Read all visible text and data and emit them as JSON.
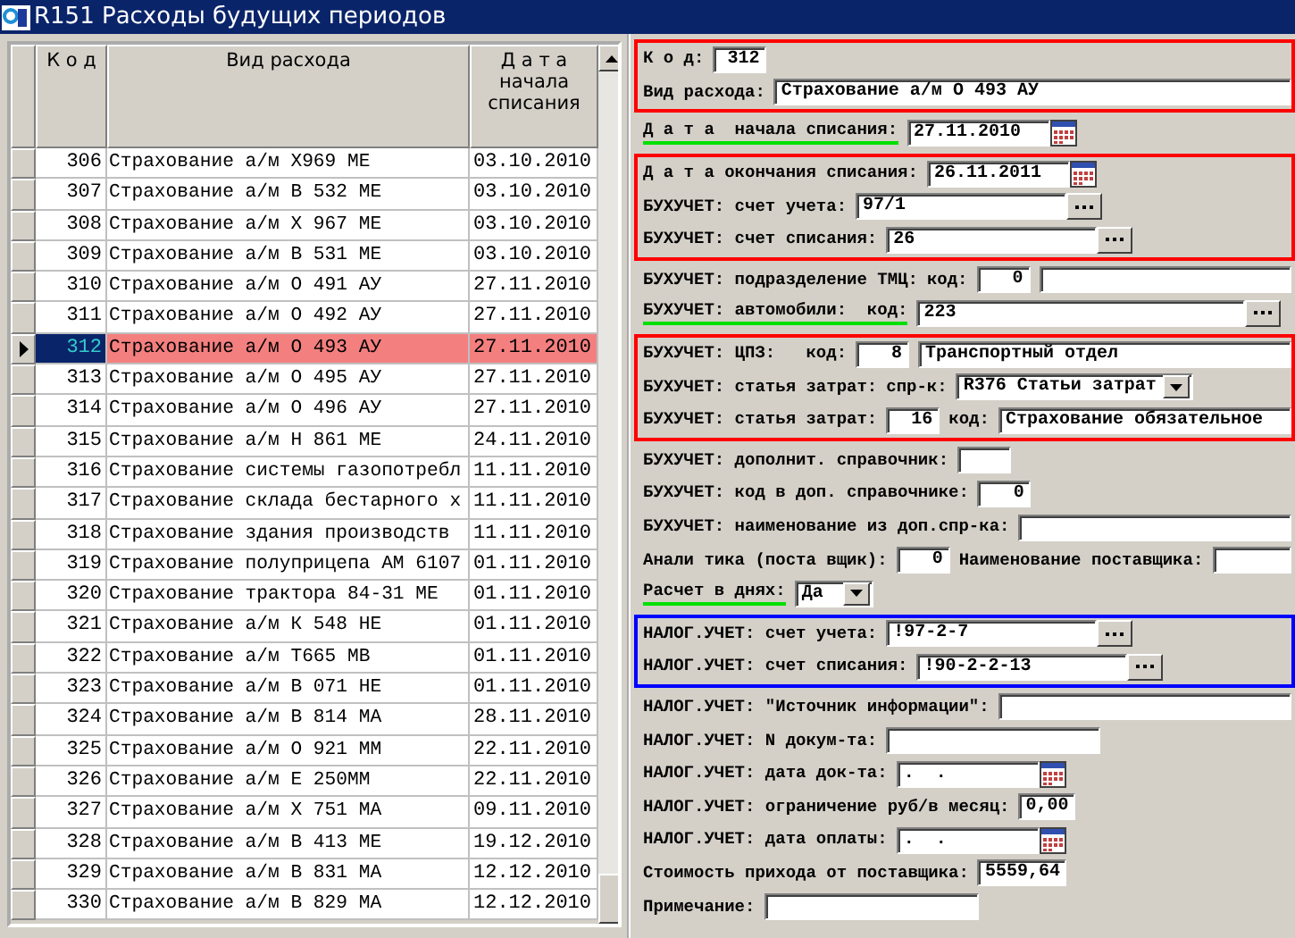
{
  "window": {
    "title": "R151 Расходы будущих периодов"
  },
  "table": {
    "columns": [
      "К о д",
      "Вид расхода",
      "Д а т а\nначала\nсписания"
    ],
    "rows": [
      {
        "code": "306",
        "name": "Страхование а/м Х969 МЕ",
        "date": "03.10.2010",
        "selected": false
      },
      {
        "code": "307",
        "name": "Страхование а/м В 532 МЕ",
        "date": "03.10.2010",
        "selected": false
      },
      {
        "code": "308",
        "name": "Страхование а/м Х 967 МЕ",
        "date": "03.10.2010",
        "selected": false
      },
      {
        "code": "309",
        "name": "Страхование а/м В 531 МЕ",
        "date": "03.10.2010",
        "selected": false
      },
      {
        "code": "310",
        "name": "Страхование а/м О 491 АУ",
        "date": "27.11.2010",
        "selected": false
      },
      {
        "code": "311",
        "name": "Страхование а/м О 492 АУ",
        "date": "27.11.2010",
        "selected": false
      },
      {
        "code": "312",
        "name": "Страхование а/м О 493 АУ",
        "date": "27.11.2010",
        "selected": true
      },
      {
        "code": "313",
        "name": "Страхование а/м О 495 АУ",
        "date": "27.11.2010",
        "selected": false
      },
      {
        "code": "314",
        "name": "Страхование а/м О 496 АУ",
        "date": "27.11.2010",
        "selected": false
      },
      {
        "code": "315",
        "name": "Страхование а/м Н 861 МЕ",
        "date": "24.11.2010",
        "selected": false
      },
      {
        "code": "316",
        "name": "Страхование системы газопотребл",
        "date": "11.11.2010",
        "selected": false
      },
      {
        "code": "317",
        "name": "Страхование склада бестарного х",
        "date": "11.11.2010",
        "selected": false
      },
      {
        "code": "318",
        "name": "Страхование здания производств",
        "date": "11.11.2010",
        "selected": false
      },
      {
        "code": "319",
        "name": "Страхование полуприцепа АМ 6107",
        "date": "01.11.2010",
        "selected": false
      },
      {
        "code": "320",
        "name": "Страхование трактора 84-31 МЕ",
        "date": "01.11.2010",
        "selected": false
      },
      {
        "code": "321",
        "name": "Страхование а/м К 548 НЕ",
        "date": "01.11.2010",
        "selected": false
      },
      {
        "code": "322",
        "name": "Страхование а/м Т665 МВ",
        "date": "01.11.2010",
        "selected": false
      },
      {
        "code": "323",
        "name": "Страхование а/м В 071 НЕ",
        "date": "01.11.2010",
        "selected": false
      },
      {
        "code": "324",
        "name": "Страхование а/м В 814 МА",
        "date": "28.11.2010",
        "selected": false
      },
      {
        "code": "325",
        "name": "Страхование а/м О 921 ММ",
        "date": "22.11.2010",
        "selected": false
      },
      {
        "code": "326",
        "name": "Страхование а/м Е 250ММ",
        "date": "22.11.2010",
        "selected": false
      },
      {
        "code": "327",
        "name": "Страхование а/м Х 751 МА",
        "date": "09.11.2010",
        "selected": false
      },
      {
        "code": "328",
        "name": "Страхование а/м В 413 МЕ",
        "date": "19.12.2010",
        "selected": false
      },
      {
        "code": "329",
        "name": "Страхование а/м В 831 МА",
        "date": "12.12.2010",
        "selected": false
      },
      {
        "code": "330",
        "name": "Страхование а/м В 829 МА",
        "date": "12.12.2010",
        "selected": false
      }
    ]
  },
  "form": {
    "groups": [
      {
        "color": "#ff0000",
        "rows": [
          {
            "items": [
              {
                "kind": "label",
                "text": "К о д:"
              },
              {
                "kind": "number",
                "value": "312"
              }
            ]
          },
          {
            "items": [
              {
                "kind": "label",
                "text": "Вид расхода:"
              },
              {
                "kind": "wide",
                "value": "Страхование а/м О 493 АУ"
              }
            ]
          }
        ]
      },
      {
        "rows": [
          {
            "items": [
              {
                "kind": "label",
                "text": "Д а т а  начала списания:",
                "underlined": true
              },
              {
                "kind": "date",
                "value": "27.11.2010"
              }
            ]
          }
        ]
      },
      {
        "color": "#ff0000",
        "rows": [
          {
            "items": [
              {
                "kind": "label",
                "text": "Д а т а окончания списания:"
              },
              {
                "kind": "date",
                "value": "26.11.2011"
              }
            ]
          },
          {
            "items": [
              {
                "kind": "label",
                "text": "БУХУЧЕТ: счет учета:"
              },
              {
                "kind": "lookup",
                "value": "97/1"
              }
            ]
          },
          {
            "items": [
              {
                "kind": "label",
                "text": "БУХУЧЕТ: счет списания:"
              },
              {
                "kind": "lookup",
                "value": "26"
              }
            ]
          }
        ]
      },
      {
        "rows": [
          {
            "items": [
              {
                "kind": "label",
                "text": "БУХУЧЕТ: подразделение ТМЦ:"
              },
              {
                "kind": "label",
                "text": "код:"
              },
              {
                "kind": "number",
                "value": "0"
              },
              {
                "kind": "wide"
              }
            ]
          },
          {
            "items": [
              {
                "kind": "label",
                "text": "БУХУЧЕТ: автомобили:  код:",
                "underlined": true
              },
              {
                "kind": "longlookup",
                "value": "223"
              }
            ]
          }
        ]
      },
      {
        "color": "#ff0000",
        "rows": [
          {
            "items": [
              {
                "kind": "label",
                "text": "БУХУЧЕТ: ЦПЗ:   код:"
              },
              {
                "kind": "number",
                "value": "8"
              },
              {
                "kind": "wide",
                "value": "Транспортный отдел"
              }
            ]
          },
          {
            "items": [
              {
                "kind": "label",
                "text": "БУХУЧЕТ: статья затрат:"
              },
              {
                "kind": "label",
                "text": "спр-к:"
              },
              {
                "kind": "select",
                "value": "R376 Статьи затрат"
              }
            ]
          },
          {
            "items": [
              {
                "kind": "label",
                "text": "БУХУЧЕТ: статья затрат:"
              },
              {
                "kind": "number",
                "value": "16"
              },
              {
                "kind": "label",
                "text": "код:"
              },
              {
                "kind": "wide",
                "value": "Страхование обязательное"
              }
            ]
          }
        ]
      },
      {
        "rows": [
          {
            "items": [
              {
                "kind": "label",
                "text": "БУХУЧЕТ: дополнит. справочник:"
              },
              {
                "kind": "number"
              }
            ]
          },
          {
            "items": [
              {
                "kind": "label",
                "text": "БУХУЧЕТ: код в доп. справочнике:"
              },
              {
                "kind": "number",
                "value": "0"
              }
            ]
          },
          {
            "items": [
              {
                "kind": "label",
                "text": "БУХУЧЕТ: наименование из доп.спр-ка:"
              },
              {
                "kind": "wide"
              }
            ]
          },
          {
            "items": [
              {
                "kind": "label",
                "text": "Анали тика (поста вщик):"
              },
              {
                "kind": "number",
                "value": "0"
              },
              {
                "kind": "label",
                "text": "Наименование поставщика:"
              },
              {
                "kind": "wide"
              }
            ]
          },
          {
            "items": [
              {
                "kind": "label",
                "text": "Расчет в днях:",
                "underlined": true
              },
              {
                "kind": "select",
                "value": "Да"
              }
            ]
          }
        ]
      },
      {
        "color": "#0000ff",
        "rows": [
          {
            "items": [
              {
                "kind": "label",
                "text": "НАЛОГ.УЧЕТ: счет учета:"
              },
              {
                "kind": "lookup",
                "value": "!97-2-7"
              }
            ]
          },
          {
            "items": [
              {
                "kind": "label",
                "text": "НАЛОГ.УЧЕТ: счет списания:"
              },
              {
                "kind": "lookup",
                "value": "!90-2-2-13"
              }
            ]
          }
        ]
      },
      {
        "rows": [
          {
            "items": [
              {
                "kind": "label",
                "text": "НАЛОГ.УЧЕТ: \"Источник информации\":"
              },
              {
                "kind": "wide"
              }
            ]
          },
          {
            "items": [
              {
                "kind": "label",
                "text": "НАЛОГ.УЧЕТ: N докум-та:"
              },
              {
                "kind": "text"
              }
            ]
          },
          {
            "items": [
              {
                "kind": "label",
                "text": "НАЛОГ.УЧЕТ: дата док-та:"
              },
              {
                "kind": "date",
                "value": ".  ."
              }
            ]
          },
          {
            "items": [
              {
                "kind": "label",
                "text": "НАЛОГ.УЧЕТ: ограничение руб/в месяц:"
              },
              {
                "kind": "number",
                "value": "0,00"
              }
            ]
          },
          {
            "items": [
              {
                "kind": "label",
                "text": "НАЛОГ.УЧЕТ: дата оплаты:"
              },
              {
                "kind": "date",
                "value": ".  ."
              }
            ]
          },
          {
            "items": [
              {
                "kind": "label",
                "text": "Стоимость прихода от поставщика:"
              },
              {
                "kind": "number",
                "value": "5559,64"
              }
            ]
          },
          {
            "items": [
              {
                "kind": "label",
                "text": "Примечание:"
              },
              {
                "kind": "text"
              }
            ]
          }
        ]
      }
    ]
  }
}
